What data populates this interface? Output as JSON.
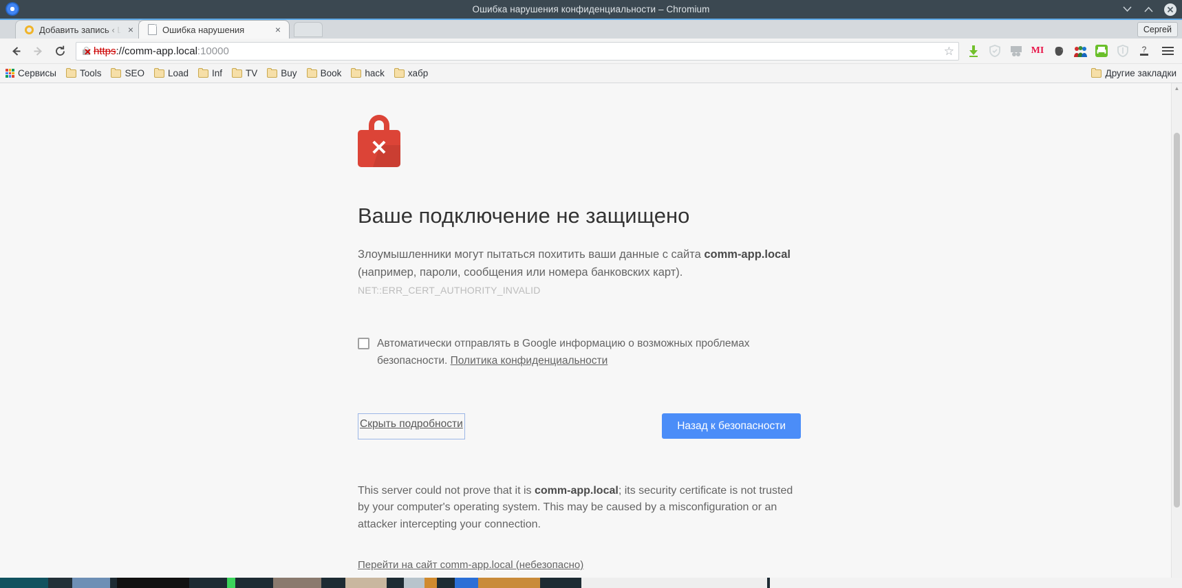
{
  "window": {
    "title": "Ошибка нарушения конфиденциальности – Chromium",
    "logo_icon": "chromium-logo-icon",
    "controls": {
      "minimize": "minimize-icon",
      "maximize": "maximize-icon",
      "close": "close-icon"
    }
  },
  "tabs": {
    "items": [
      {
        "title": "Добавить запись ‹ L",
        "favicon": "wordpress-favicon-icon",
        "active": false,
        "close": "×"
      },
      {
        "title": "Ошибка нарушения",
        "favicon": "page-favicon-icon",
        "active": true,
        "close": "×"
      }
    ],
    "profile_label": "Сергей"
  },
  "toolbar": {
    "back_icon": "back-arrow-icon",
    "forward_icon": "forward-arrow-icon",
    "reload_icon": "reload-icon",
    "omnibox": {
      "security_icon": "broken-lock-icon",
      "url_scheme": "https",
      "url_separator": "://",
      "url_host": "comm-app.local",
      "url_port": ":10000",
      "full_url": "https://comm-app.local:10000",
      "star_icon": "bookmark-star-icon"
    },
    "extensions": [
      {
        "name": "download-arrow-icon",
        "glyph": "⬇",
        "color": "#6abf2a"
      },
      {
        "name": "shield-outline-icon",
        "glyph": "🛡",
        "color": "#cfd6d8"
      },
      {
        "name": "gray-tab-icon",
        "glyph": "▭",
        "color": "#b4b9bc"
      },
      {
        "name": "mi-extension-icon",
        "glyph": "MI",
        "color": "#e8174a"
      },
      {
        "name": "evernote-elephant-icon",
        "glyph": "🐘",
        "color": "#4c4c4c"
      },
      {
        "name": "people-group-icon",
        "glyph": "👥",
        "color": "#3a6bbf"
      },
      {
        "name": "print-friendly-icon",
        "glyph": "🖨",
        "color": "#6abf2a"
      },
      {
        "name": "adblock-shield-icon",
        "glyph": "🛡",
        "color": "#cfd6d8"
      },
      {
        "name": "help-question-icon",
        "glyph": "?",
        "color": "#555555"
      }
    ],
    "menu_icon": "hamburger-menu-icon"
  },
  "bookmarks": {
    "items": [
      {
        "label": "Сервисы",
        "icon": "apps-grid-icon"
      },
      {
        "label": "Tools",
        "icon": "folder-icon"
      },
      {
        "label": "SEO",
        "icon": "folder-icon"
      },
      {
        "label": "Load",
        "icon": "folder-icon"
      },
      {
        "label": "Inf",
        "icon": "folder-icon"
      },
      {
        "label": "TV",
        "icon": "folder-icon"
      },
      {
        "label": "Buy",
        "icon": "folder-icon"
      },
      {
        "label": "Book",
        "icon": "folder-icon"
      },
      {
        "label": "hack",
        "icon": "folder-icon"
      },
      {
        "label": "хабр",
        "icon": "folder-icon"
      }
    ],
    "other": {
      "label": "Другие закладки",
      "icon": "folder-icon"
    }
  },
  "page": {
    "icon": "red-lock-error-icon",
    "heading": "Ваше подключение не защищено",
    "lead_part1": "Злоумышленники могут пытаться похитить ваши данные с сайта ",
    "lead_host": "comm-app.local",
    "lead_part2": " (например, пароли, сообщения или номера банковских карт).",
    "error_code": "NET::ERR_CERT_AUTHORITY_INVALID",
    "optout_text": "Автоматически отправлять в Google информацию о возможных проблемах безопасности. ",
    "optout_link": "Политика конфиденциальности",
    "optout_checked": false,
    "details_toggle": "Скрыть подробности",
    "primary_button": "Назад к безопасности",
    "primary_button_color": "#4b8df8",
    "details_part1": "This server could not prove that it is ",
    "details_host": "comm-app.local",
    "details_part2": "; its security certificate is not trusted by your computer's operating system. This may be caused by a misconfiguration or an attacker intercepting your connection.",
    "proceed_link": "Перейти на сайт comm-app.local (небезопасно)"
  },
  "scrollbar": {
    "up_icon": "scroll-up-arrow-icon",
    "down_icon": "scroll-down-arrow-icon"
  }
}
